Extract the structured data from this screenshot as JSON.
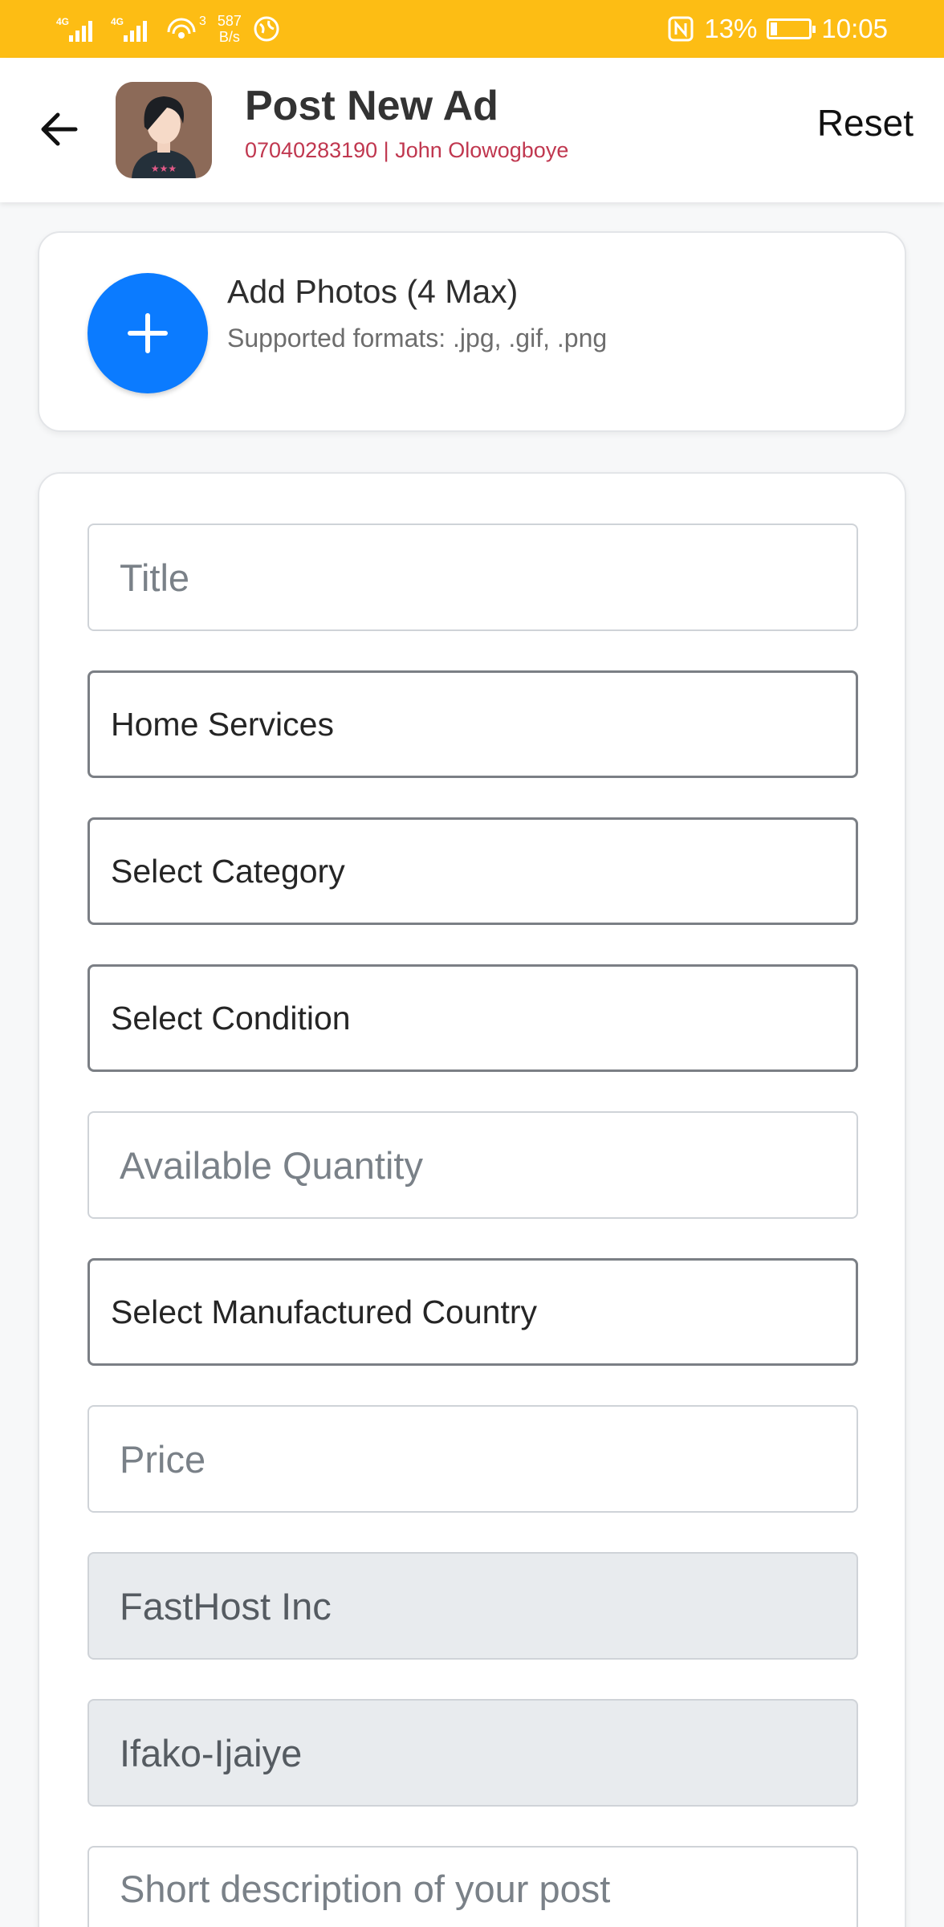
{
  "status_bar": {
    "signal_1": "4G",
    "signal_2": "4G",
    "wifi_count": "3",
    "speed_value": "587",
    "speed_unit": "B/s",
    "battery": "13%",
    "time": "10:05"
  },
  "header": {
    "title": "Post New Ad",
    "subtitle": "07040283190 | John Olowogboye",
    "reset_label": "Reset"
  },
  "photos": {
    "title": "Add Photos (4 Max)",
    "hint": "Supported formats: .jpg, .gif, .png"
  },
  "form": {
    "title_placeholder": "Title",
    "service_type": "Home Services",
    "category": "Select Category",
    "condition": "Select Condition",
    "quantity_placeholder": "Available Quantity",
    "country": "Select Manufactured Country",
    "price_placeholder": "Price",
    "company": "FastHost Inc",
    "location": "Ifako-Ijaiye",
    "description_placeholder": "Short description of your post"
  },
  "colors": {
    "status_bar": "#fdbd14",
    "accent": "#0b7bff",
    "subtitle": "#c0374f"
  }
}
